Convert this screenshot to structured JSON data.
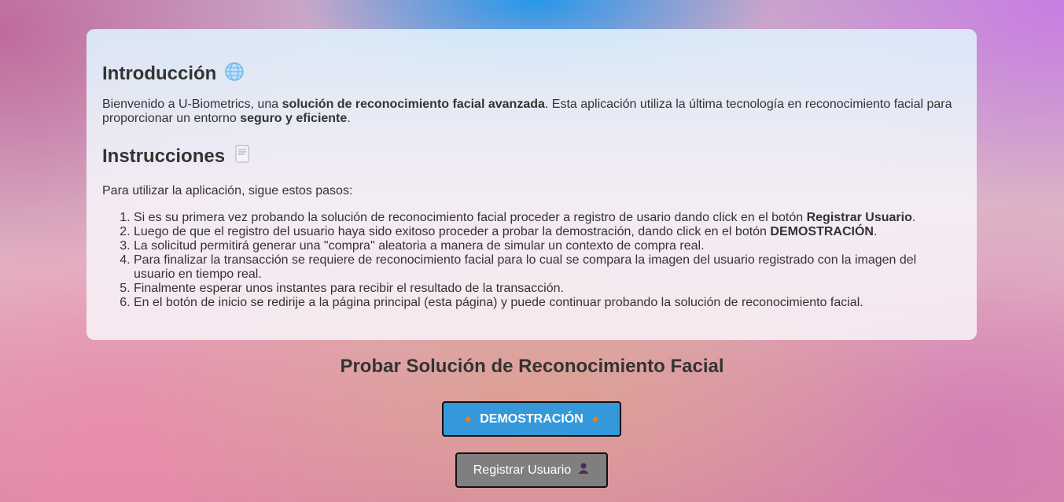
{
  "intro": {
    "title": "Introducción",
    "icon": "globe-icon",
    "text_1": "Bienvenido a U-Biometrics, una ",
    "bold_1": "solución de reconocimiento facial avanzada",
    "text_2": ". Esta aplicación utiliza la última tecnología en reconocimiento facial para proporcionar un entorno ",
    "bold_2": "seguro y eficiente",
    "text_3": "."
  },
  "instructions": {
    "title": "Instrucciones",
    "icon": "document-icon",
    "lead": "Para utilizar la aplicación, sigue estos pasos:",
    "steps": [
      {
        "text": "Si es su primera vez probando la solución de reconocimiento facial proceder a registro de usario dando click en el botón ",
        "bold": "Registrar Usuario",
        "after": "."
      },
      {
        "text": "Luego de que el registro del usuario haya sido exitoso proceder a probar la demostración, dando click en el botón ",
        "bold": "DEMOSTRACIÓN",
        "after": "."
      },
      {
        "text": "La solicitud permitirá generar una \"compra\" aleatoria a manera de simular un contexto de compra real.",
        "bold": "",
        "after": ""
      },
      {
        "text": "Para finalizar la transacción se requiere de reconocimiento facial para lo cual se compara la imagen del usuario registrado con la imagen del usuario en tiempo real.",
        "bold": "",
        "after": ""
      },
      {
        "text": "Finalmente esperar unos instantes para recibir el resultado de la transacción.",
        "bold": "",
        "after": ""
      },
      {
        "text": "En el botón de inicio se redirije a la página principal (esta página) y puede continuar probando la solución de reconocimiento facial.",
        "bold": "",
        "after": ""
      }
    ]
  },
  "cta": {
    "title": "Probar Solución de Reconocimiento Facial",
    "demo_label": "DEMOSTRACIÓN",
    "register_label": "Registrar Usuario",
    "register_icon": "user-icon"
  },
  "colors": {
    "demo_button": "#3498db",
    "register_button": "#7f7f7f",
    "diamond": "#e67e22",
    "text": "#333333"
  }
}
